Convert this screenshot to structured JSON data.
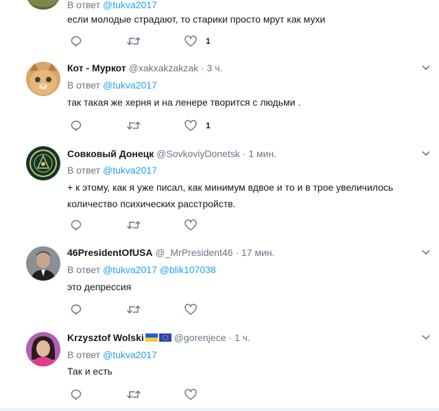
{
  "tweets": [
    {
      "text": "если молодые страдают, то старики просто мрут как мухи",
      "reply_to": "@tukva2017",
      "reply_prefix": "В ответ",
      "likes": "1"
    },
    {
      "name": "Кот - Муркот",
      "handle": "@xakxakzakzak",
      "dot": "·",
      "time": "3 ч.",
      "reply_prefix": "В ответ",
      "reply_to": "@tukva2017",
      "text": "так такая же херня и на ленере творится с людьми .",
      "likes": "1"
    },
    {
      "name": "Совковый Донецк",
      "handle": "@SovkoviyDonetsk",
      "dot": "·",
      "time": "1 мин.",
      "reply_prefix": "В ответ",
      "reply_to": "@tukva2017",
      "text": "+ к этому, как я уже писал, как минимум вдвое и то и в трое увеличилось количество психических расстройств."
    },
    {
      "name": "46PresidentOfUSA",
      "handle": "@_MrPresident46",
      "dot": "·",
      "time": "17 мин.",
      "reply_prefix": "В ответ",
      "reply_to": "@tukva2017",
      "reply_to_2": "@blik107038",
      "text": "это депрессия"
    },
    {
      "name": "Krzysztof Wolski",
      "handle": "@gorenjece",
      "dot": "·",
      "time": "1 ч.",
      "reply_prefix": "В ответ",
      "reply_to": "@tukva2017",
      "text": "Так и есть"
    }
  ],
  "icons": {
    "reply": "reply-icon",
    "retweet": "retweet-icon",
    "like": "heart-icon",
    "more": "chevron-down-icon"
  },
  "colors": {
    "link": "#1da1f2",
    "muted": "#657786",
    "text": "#14171a",
    "divider": "#e6ecf0"
  }
}
